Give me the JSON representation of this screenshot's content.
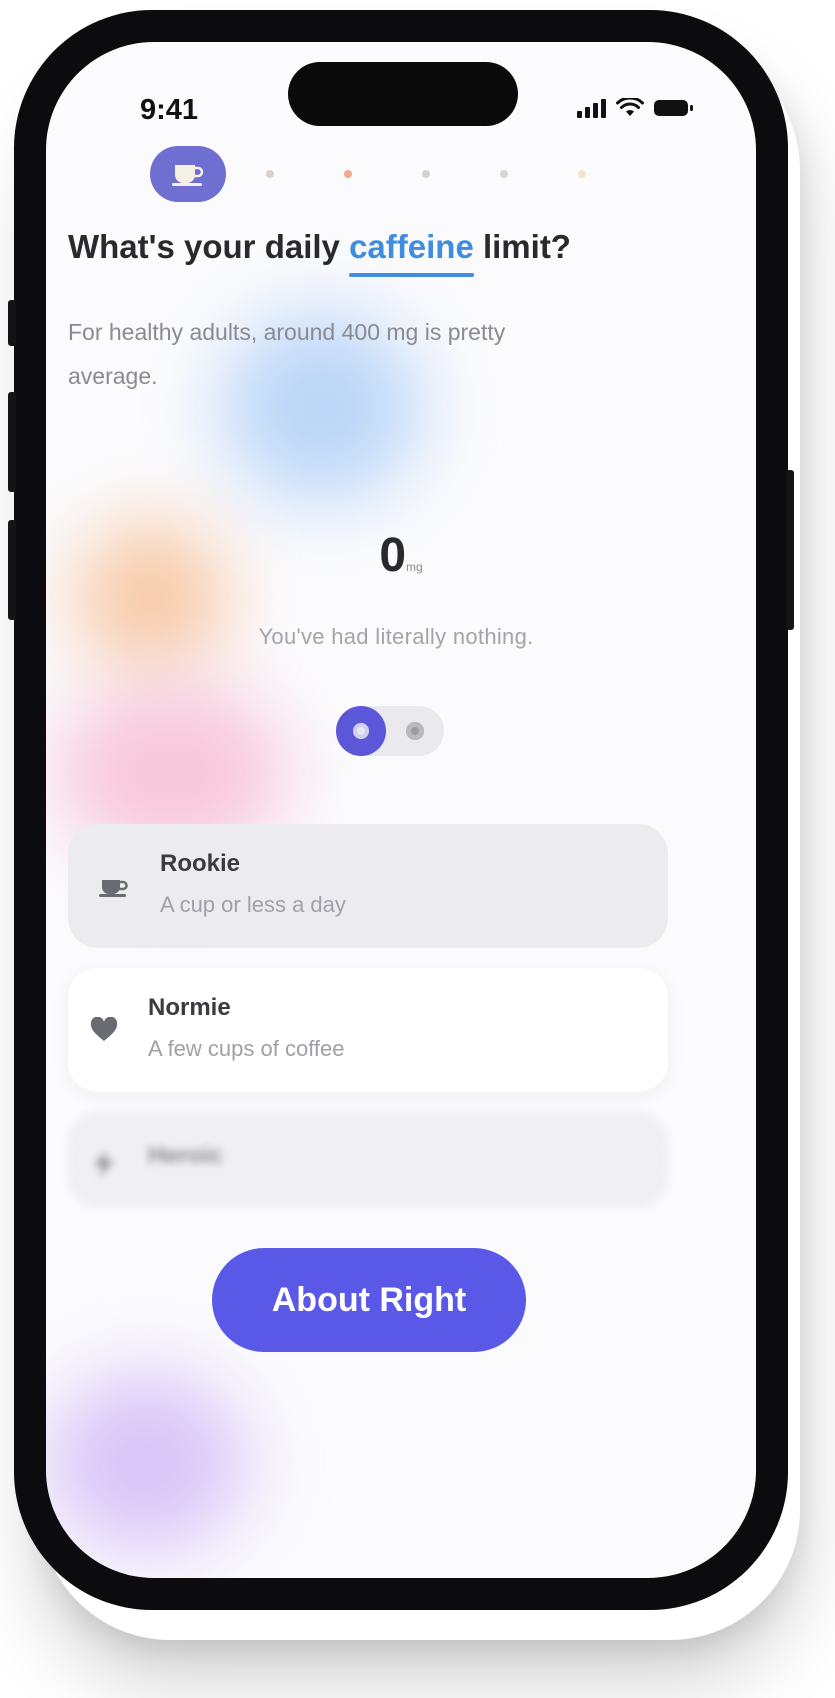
{
  "status_bar": {
    "time": "9:41",
    "icons": [
      "signal-icon",
      "wifi-icon",
      "battery-icon"
    ]
  },
  "progress": {
    "active_step_icon": "coffee-cup-icon",
    "steps_total": 6,
    "current_step": 1,
    "dot_colors": [
      "#d9d0c8",
      "#f2a98f",
      "#cfd3d8",
      "#d2d7d2",
      "#f3e6cc"
    ]
  },
  "question": {
    "prefix": "What's your daily ",
    "highlight": "caffeine",
    "suffix": " limit?",
    "subtitle": "For healthy adults, around 400 mg is pretty average."
  },
  "intake": {
    "value": "0",
    "unit": "mg",
    "note": "You've had literally nothing."
  },
  "options": [
    {
      "icon": "coffee-cup-icon",
      "title": "Rookie",
      "subtitle": "A cup or less a day",
      "selected": true
    },
    {
      "icon": "heart-icon",
      "title": "Normie",
      "subtitle": "A few cups of coffee",
      "selected": false
    },
    {
      "icon": "bolt-icon",
      "title": "Heroic",
      "subtitle": "",
      "selected": false
    }
  ],
  "cta": {
    "label": "About Right"
  },
  "colors": {
    "accent": "#3f8de0",
    "primary": "#5a58e6",
    "step_active": "#6f6ed1"
  }
}
